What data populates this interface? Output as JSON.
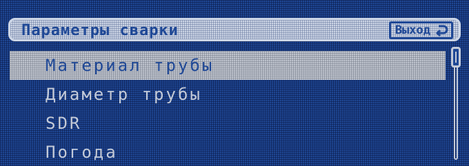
{
  "header": {
    "title": "Параметры сварки",
    "exit_label": "Выход",
    "exit_icon": "return-arrow-icon"
  },
  "menu": {
    "items": [
      {
        "label": "Материал трубы",
        "selected": true
      },
      {
        "label": "Диаметр трубы",
        "selected": false
      },
      {
        "label": "SDR",
        "selected": false
      },
      {
        "label": "Погода",
        "selected": false
      }
    ]
  },
  "colors": {
    "background": "#1f4896",
    "foreground": "#c3cad8",
    "highlight": "#bfc4ce"
  }
}
